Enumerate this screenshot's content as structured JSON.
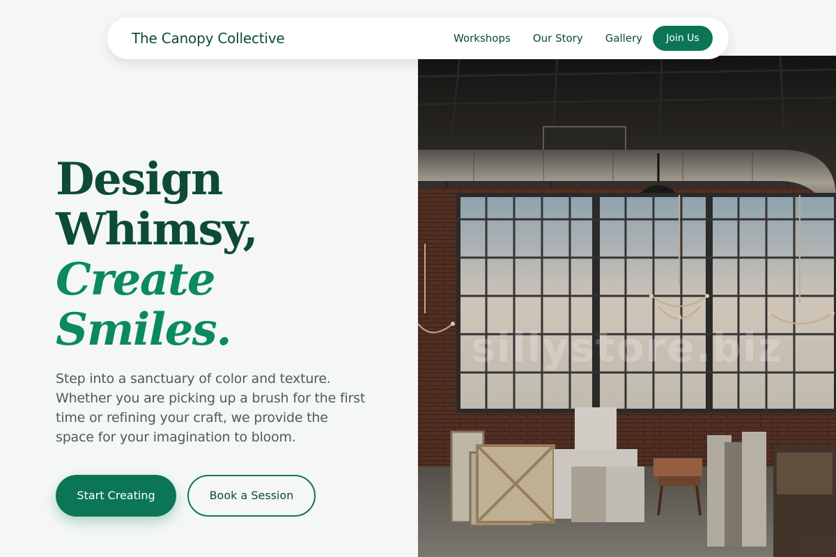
{
  "nav": {
    "brand": "The Canopy Collective",
    "links": [
      "Workshops",
      "Our Story",
      "Gallery"
    ],
    "cta": "Join Us"
  },
  "hero": {
    "headline": [
      "Design",
      "Whimsy,"
    ],
    "headline_accent": [
      "Create",
      "Smiles."
    ],
    "subcopy": "Step into a sanctuary of color and texture. Whether you are picking up a brush for the first time or refining your craft, we provide the space for your imagination to bloom.",
    "primary_cta": "Start Creating",
    "secondary_cta": "Book a Session",
    "image_watermark": "sillystore.biz"
  },
  "colors": {
    "brand_dark": "#0d4a38",
    "brand_accent": "#0b8a5f",
    "button": "#0b7556",
    "page_bg": "#f4f7f6"
  }
}
